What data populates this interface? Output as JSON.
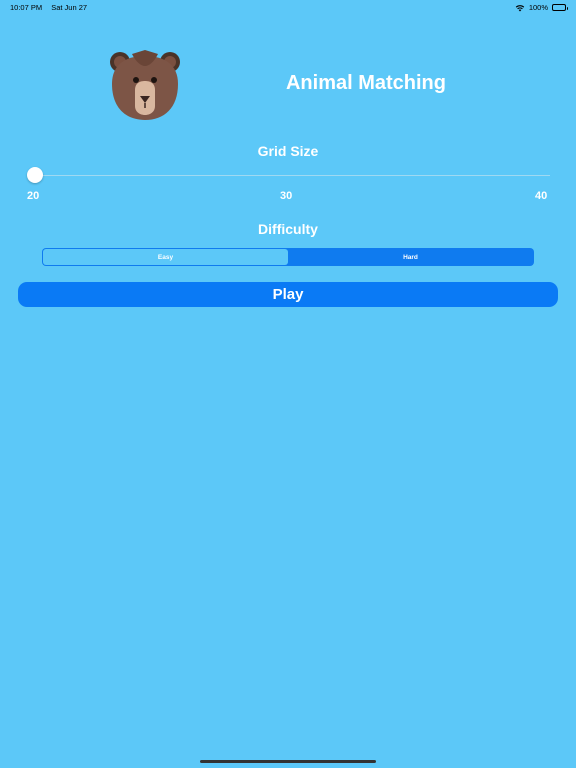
{
  "status_bar": {
    "time": "10:07 PM",
    "date": "Sat Jun 27",
    "battery": "100%"
  },
  "header": {
    "title": "Animal Matching",
    "icon": "bear-face-icon"
  },
  "grid_size": {
    "label": "Grid Size",
    "min_label": "20",
    "mid_label": "30",
    "max_label": "40",
    "value": 20
  },
  "difficulty": {
    "label": "Difficulty",
    "options": [
      "Easy",
      "Hard"
    ],
    "selected": "Easy"
  },
  "play_button": {
    "label": "Play"
  },
  "colors": {
    "background": "#5cc8f8",
    "accent": "#0a7af5",
    "segment_background": "#0f7bef"
  }
}
